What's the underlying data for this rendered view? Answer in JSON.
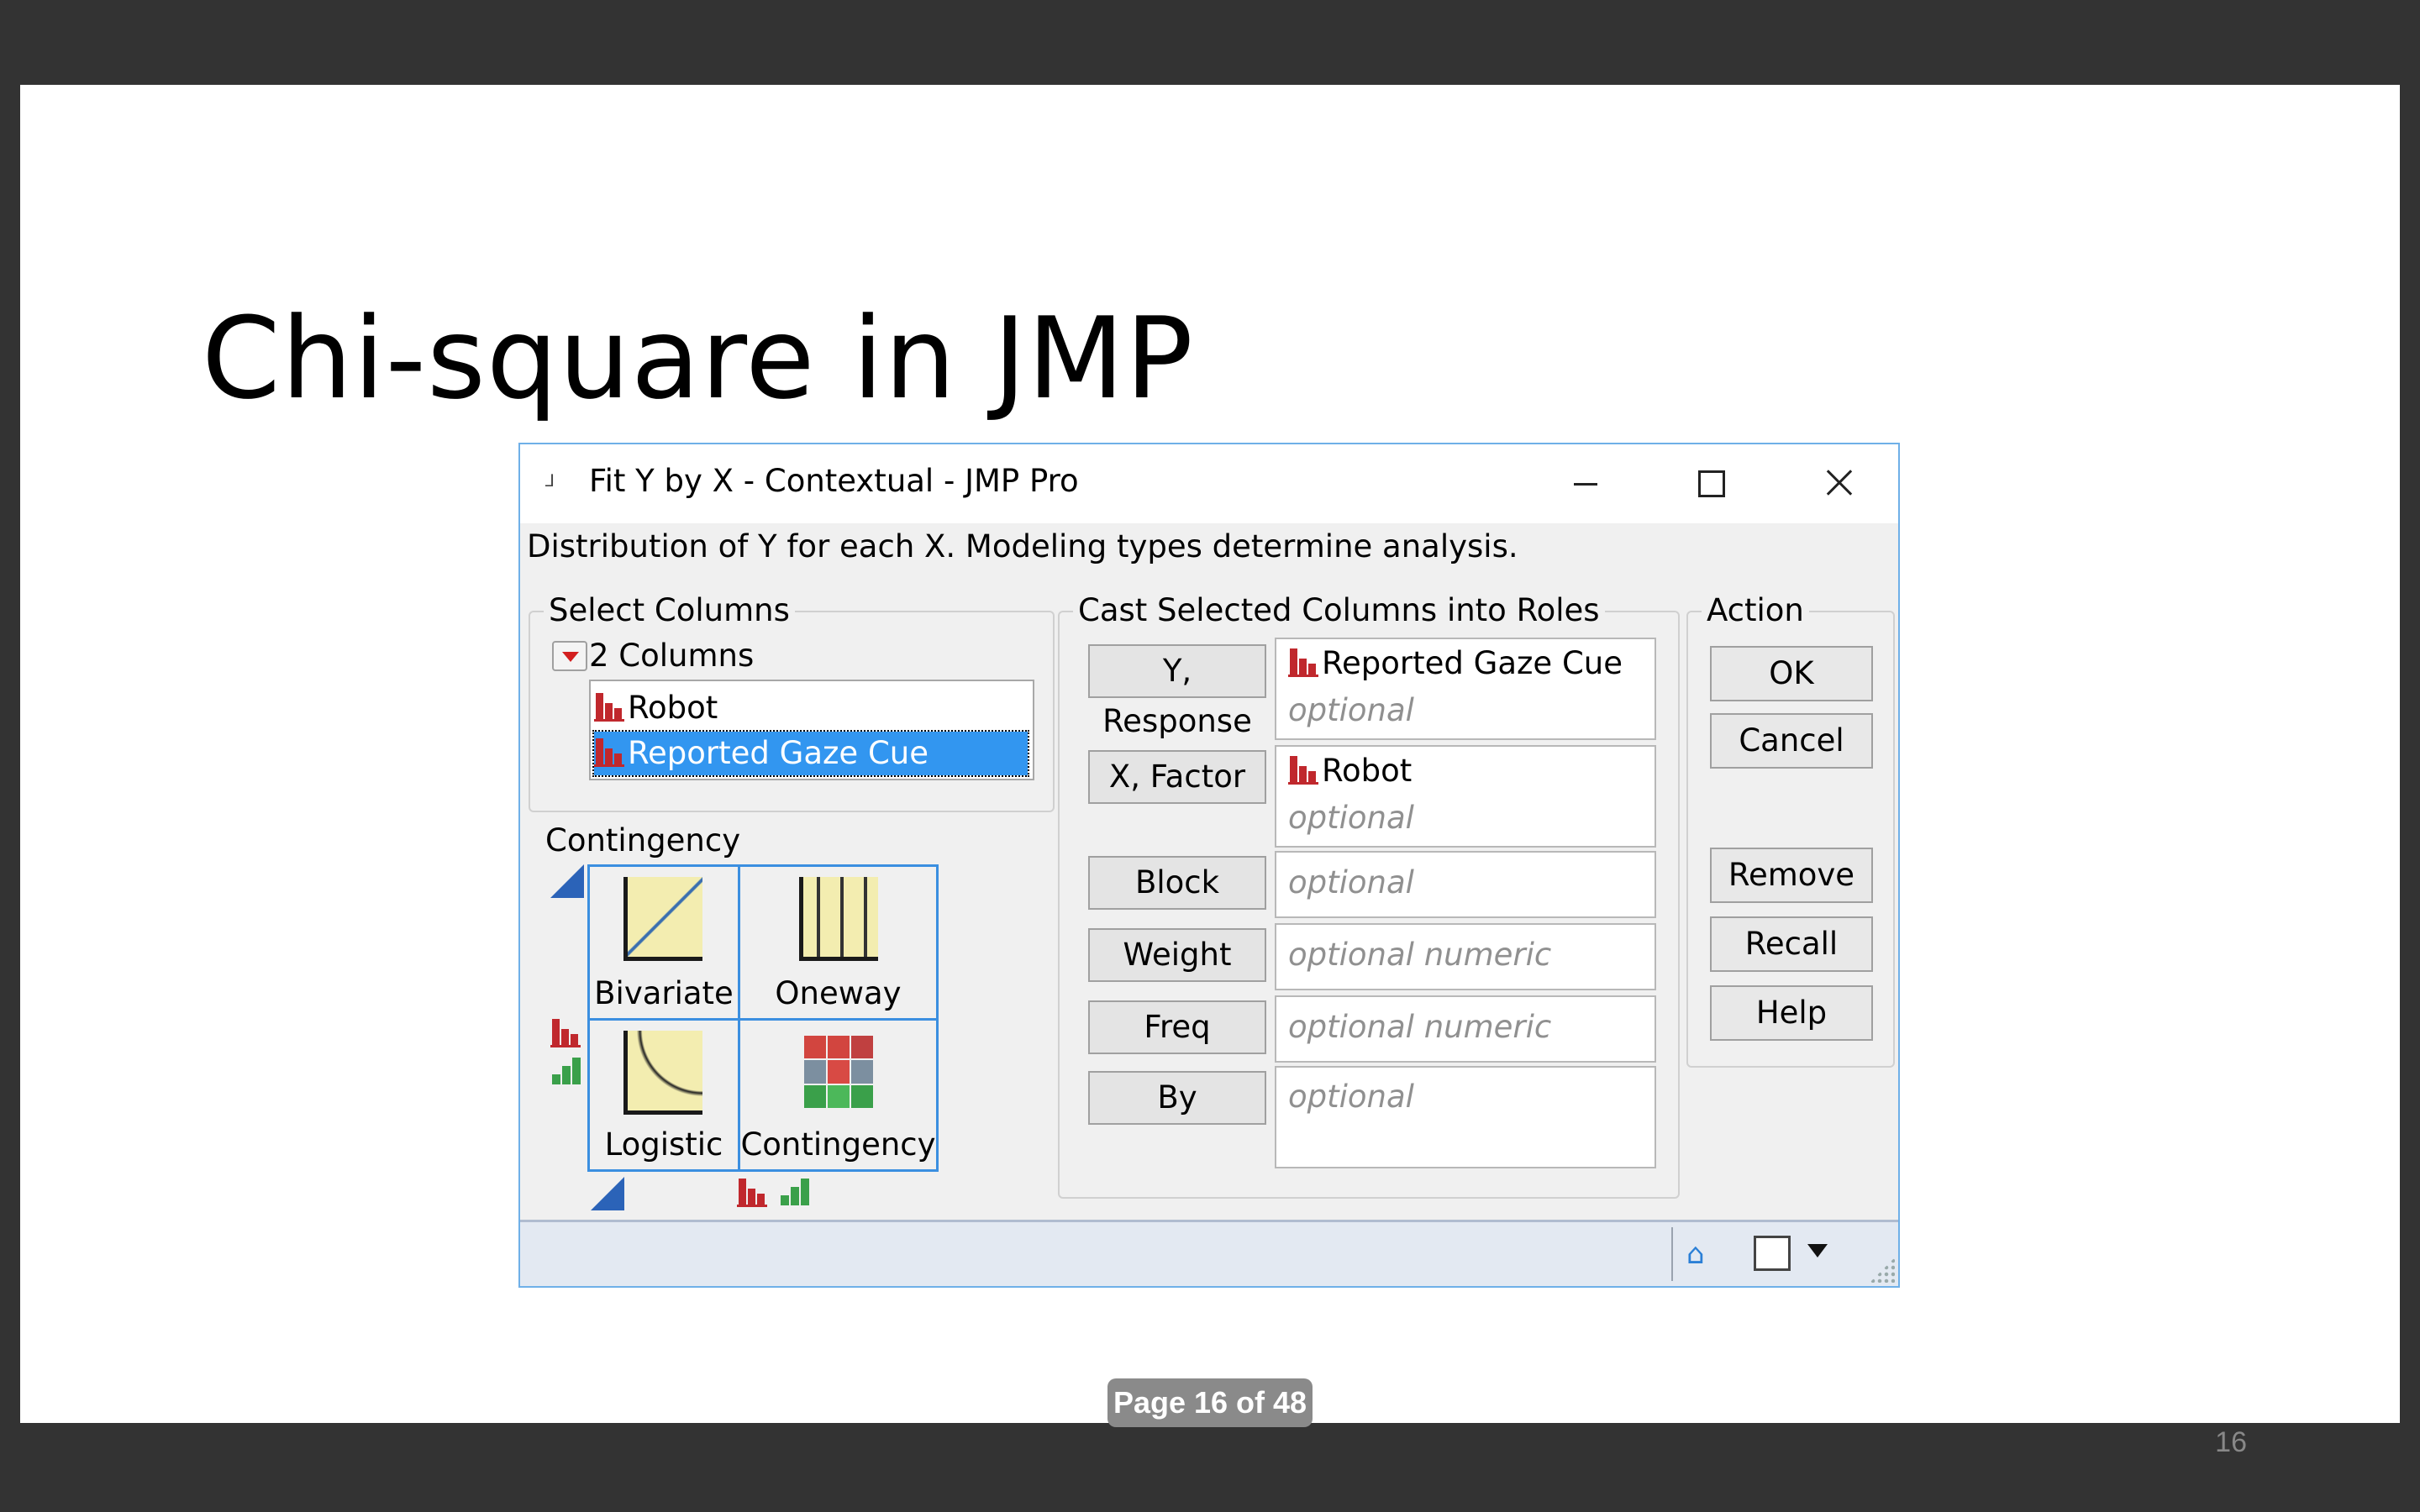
{
  "slide": {
    "title": "Chi-square in JMP",
    "slide_number": "16",
    "pager": "Page 16 of 48"
  },
  "dialog": {
    "title": "Fit Y by X - Contextual - JMP Pro",
    "description": "Distribution of Y for each X. Modeling types determine analysis.",
    "select_columns": {
      "label": "Select Columns",
      "count": "2 Columns",
      "columns": [
        {
          "name": "Robot",
          "selected": false
        },
        {
          "name": "Reported Gaze Cue",
          "selected": true
        }
      ]
    },
    "contingency": {
      "label": "Contingency",
      "cells": [
        "Bivariate",
        "Oneway",
        "Logistic",
        "Contingency"
      ]
    },
    "cast": {
      "label": "Cast Selected Columns into Roles",
      "roles": [
        {
          "button": "Y, Response",
          "value": "Reported Gaze Cue",
          "placeholder": "optional"
        },
        {
          "button": "X, Factor",
          "value": "Robot",
          "placeholder": "optional"
        },
        {
          "button": "Block",
          "value": "",
          "placeholder": "optional"
        },
        {
          "button": "Weight",
          "value": "",
          "placeholder": "optional numeric"
        },
        {
          "button": "Freq",
          "value": "",
          "placeholder": "optional numeric"
        },
        {
          "button": "By",
          "value": "",
          "placeholder": "optional"
        }
      ]
    },
    "action": {
      "label": "Action",
      "buttons": [
        "OK",
        "Cancel",
        "Remove",
        "Recall",
        "Help"
      ]
    }
  },
  "colors": {
    "selection": "#3296f0",
    "nominal_icon": "#c0282d",
    "ordinal_icon": "#3aa04a",
    "window_border": "#6fb0e8"
  }
}
